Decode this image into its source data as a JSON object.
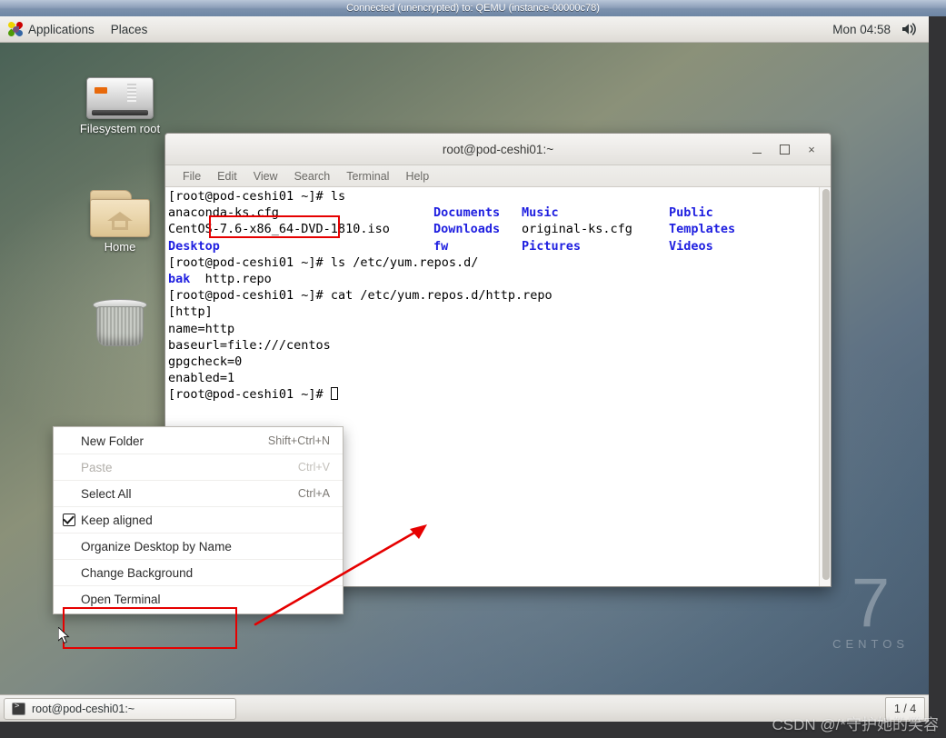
{
  "vnc": {
    "banner": "Connected (unencrypted) to: QEMU (instance-00000c78)"
  },
  "gnome_panel": {
    "applications_label": "Applications",
    "places_label": "Places",
    "clock": "Mon 04:58",
    "volume_icon": "speaker-icon"
  },
  "desktop": {
    "icons": [
      {
        "name": "filesystem-root",
        "label": "Filesystem root",
        "art": "hdd-icon"
      },
      {
        "name": "home",
        "label": "Home",
        "art": "folder-home-icon"
      },
      {
        "name": "trash",
        "label": "",
        "art": "trash-icon"
      }
    ],
    "watermark": {
      "number": "7",
      "word": "CENTOS"
    }
  },
  "terminal": {
    "title": "root@pod-ceshi01:~",
    "window_buttons": {
      "minimize": "minimize-icon",
      "maximize": "maximize-icon",
      "close": "×"
    },
    "menus": [
      "File",
      "Edit",
      "View",
      "Search",
      "Terminal",
      "Help"
    ],
    "lines": {
      "l1_prompt": "[root@pod-ceshi01 ~]# ",
      "l1_cmd": "ls",
      "ls_row1": {
        "c1": "anaconda-ks.cfg",
        "c2": "Documents",
        "c3": "Music",
        "c4": "Public"
      },
      "ls_row2": {
        "c1": "CentOS-7.6-x86_64-DVD-1810.iso",
        "c2": "Downloads",
        "c3": "original-ks.cfg",
        "c4": "Templates"
      },
      "ls_row3": {
        "c1": "Desktop",
        "c2": "fw",
        "c3": "Pictures",
        "c4": "Videos"
      },
      "l2_prompt": "[root@pod-ceshi01 ~]# ",
      "l2_cmd": "ls /etc/yum.repos.d/",
      "repos_dir": "bak",
      "repos_file": "  http.repo",
      "l3_prompt": "[root@pod-ceshi01 ~]# ",
      "l3_cmd": "cat /etc/yum.repos.d/http.repo",
      "cfg1": "[http]",
      "cfg2": "name=http",
      "cfg3": "baseurl=file:///centos",
      "cfg4": "gpgcheck=0",
      "cfg5": "enabled=1",
      "l4_prompt": "[root@pod-ceshi01 ~]# "
    }
  },
  "context_menu": {
    "items": [
      {
        "label": "New Folder",
        "accel": "Shift+Ctrl+N",
        "disabled": false,
        "checked": false
      },
      {
        "label": "Paste",
        "accel": "Ctrl+V",
        "disabled": true,
        "checked": false
      },
      {
        "label": "Select All",
        "accel": "Ctrl+A",
        "disabled": false,
        "checked": false
      },
      {
        "label": "Keep aligned",
        "accel": "",
        "disabled": false,
        "checked": true
      },
      {
        "label": "Organize Desktop by Name",
        "accel": "",
        "disabled": false,
        "checked": false
      },
      {
        "label": "Change Background",
        "accel": "",
        "disabled": false,
        "checked": false
      },
      {
        "label": "Open Terminal",
        "accel": "",
        "disabled": false,
        "checked": false
      }
    ]
  },
  "taskbar": {
    "task_label": "root@pod-ceshi01:~",
    "workspace": "1 / 4"
  },
  "overlay": {
    "csdn_watermark": "CSDN @/*守护她的笑容",
    "annotation_color": "#e60000"
  }
}
